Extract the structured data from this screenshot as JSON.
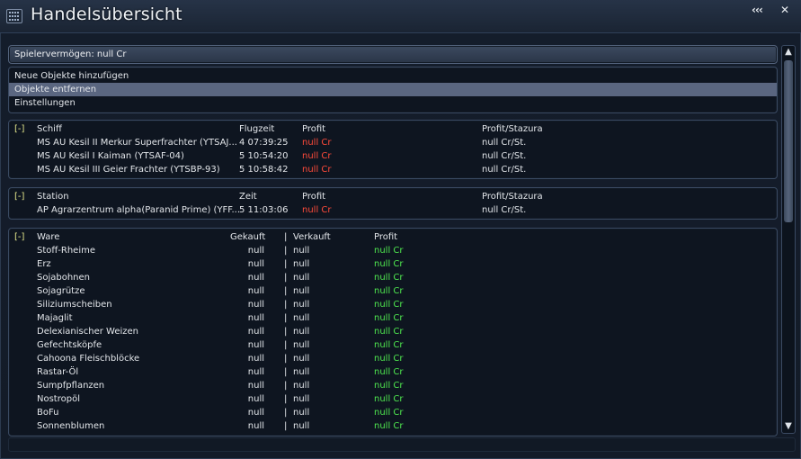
{
  "window": {
    "title": "Handelsübersicht",
    "collapse": "‹‹‹",
    "close": "✕"
  },
  "assets": {
    "label": "Spielervermögen: null Cr"
  },
  "menu": [
    {
      "label": "Neue Objekte hinzufügen"
    },
    {
      "label": "Objekte entfernen"
    },
    {
      "label": "Einstellungen"
    }
  ],
  "ships": {
    "toggle": "[-]",
    "headers": {
      "name": "Schiff",
      "time": "Flugzeit",
      "profit": "Profit",
      "rate": "Profit/Stazura"
    },
    "rows": [
      {
        "name": "MS AU Kesil II Merkur Superfrachter (YTSAJ...",
        "time": "4 07:39:25",
        "profit": "null Cr",
        "rate": "null Cr/St."
      },
      {
        "name": "MS AU Kesil I Kaiman (YTSAF-04)",
        "time": "5 10:54:20",
        "profit": "null Cr",
        "rate": "null Cr/St."
      },
      {
        "name": "MS AU Kesil III Geier Frachter (YTSBP-93)",
        "time": "5 10:58:42",
        "profit": "null Cr",
        "rate": "null Cr/St."
      }
    ]
  },
  "stations": {
    "toggle": "[-]",
    "headers": {
      "name": "Station",
      "time": "Zeit",
      "profit": "Profit",
      "rate": "Profit/Stazura"
    },
    "rows": [
      {
        "name": "AP Agrarzentrum alpha(Paranid Prime) (YFF...",
        "time": "5 11:03:06",
        "profit": "null Cr",
        "rate": "null Cr/St."
      }
    ]
  },
  "goods": {
    "toggle": "[-]",
    "headers": {
      "name": "Ware",
      "bought": "Gekauft",
      "sep": "|",
      "sold": "Verkauft",
      "profit": "Profit"
    },
    "rows": [
      {
        "name": "Stoff-Rheime",
        "bought": "null",
        "sold": "null",
        "profit": "null Cr"
      },
      {
        "name": "Erz",
        "bought": "null",
        "sold": "null",
        "profit": "null Cr"
      },
      {
        "name": "Sojabohnen",
        "bought": "null",
        "sold": "null",
        "profit": "null Cr"
      },
      {
        "name": "Sojagrütze",
        "bought": "null",
        "sold": "null",
        "profit": "null Cr"
      },
      {
        "name": "Siliziumscheiben",
        "bought": "null",
        "sold": "null",
        "profit": "null Cr"
      },
      {
        "name": "Majaglit",
        "bought": "null",
        "sold": "null",
        "profit": "null Cr"
      },
      {
        "name": "Delexianischer Weizen",
        "bought": "null",
        "sold": "null",
        "profit": "null Cr"
      },
      {
        "name": "Gefechtsköpfe",
        "bought": "null",
        "sold": "null",
        "profit": "null Cr"
      },
      {
        "name": "Cahoona Fleischblöcke",
        "bought": "null",
        "sold": "null",
        "profit": "null Cr"
      },
      {
        "name": "Rastar-Öl",
        "bought": "null",
        "sold": "null",
        "profit": "null Cr"
      },
      {
        "name": "Sumpfpflanzen",
        "bought": "null",
        "sold": "null",
        "profit": "null Cr"
      },
      {
        "name": "Nostropöl",
        "bought": "null",
        "sold": "null",
        "profit": "null Cr"
      },
      {
        "name": "BoFu",
        "bought": "null",
        "sold": "null",
        "profit": "null Cr"
      },
      {
        "name": "Sonnenblumen",
        "bought": "null",
        "sold": "null",
        "profit": "null Cr"
      }
    ]
  },
  "scrollbar": {
    "up": "▲",
    "down": "▼"
  },
  "colors": {
    "negative": "#ff4a3a",
    "positive": "#4fe84f",
    "toggle": "#e2e48a",
    "selected": "#5a6680"
  }
}
